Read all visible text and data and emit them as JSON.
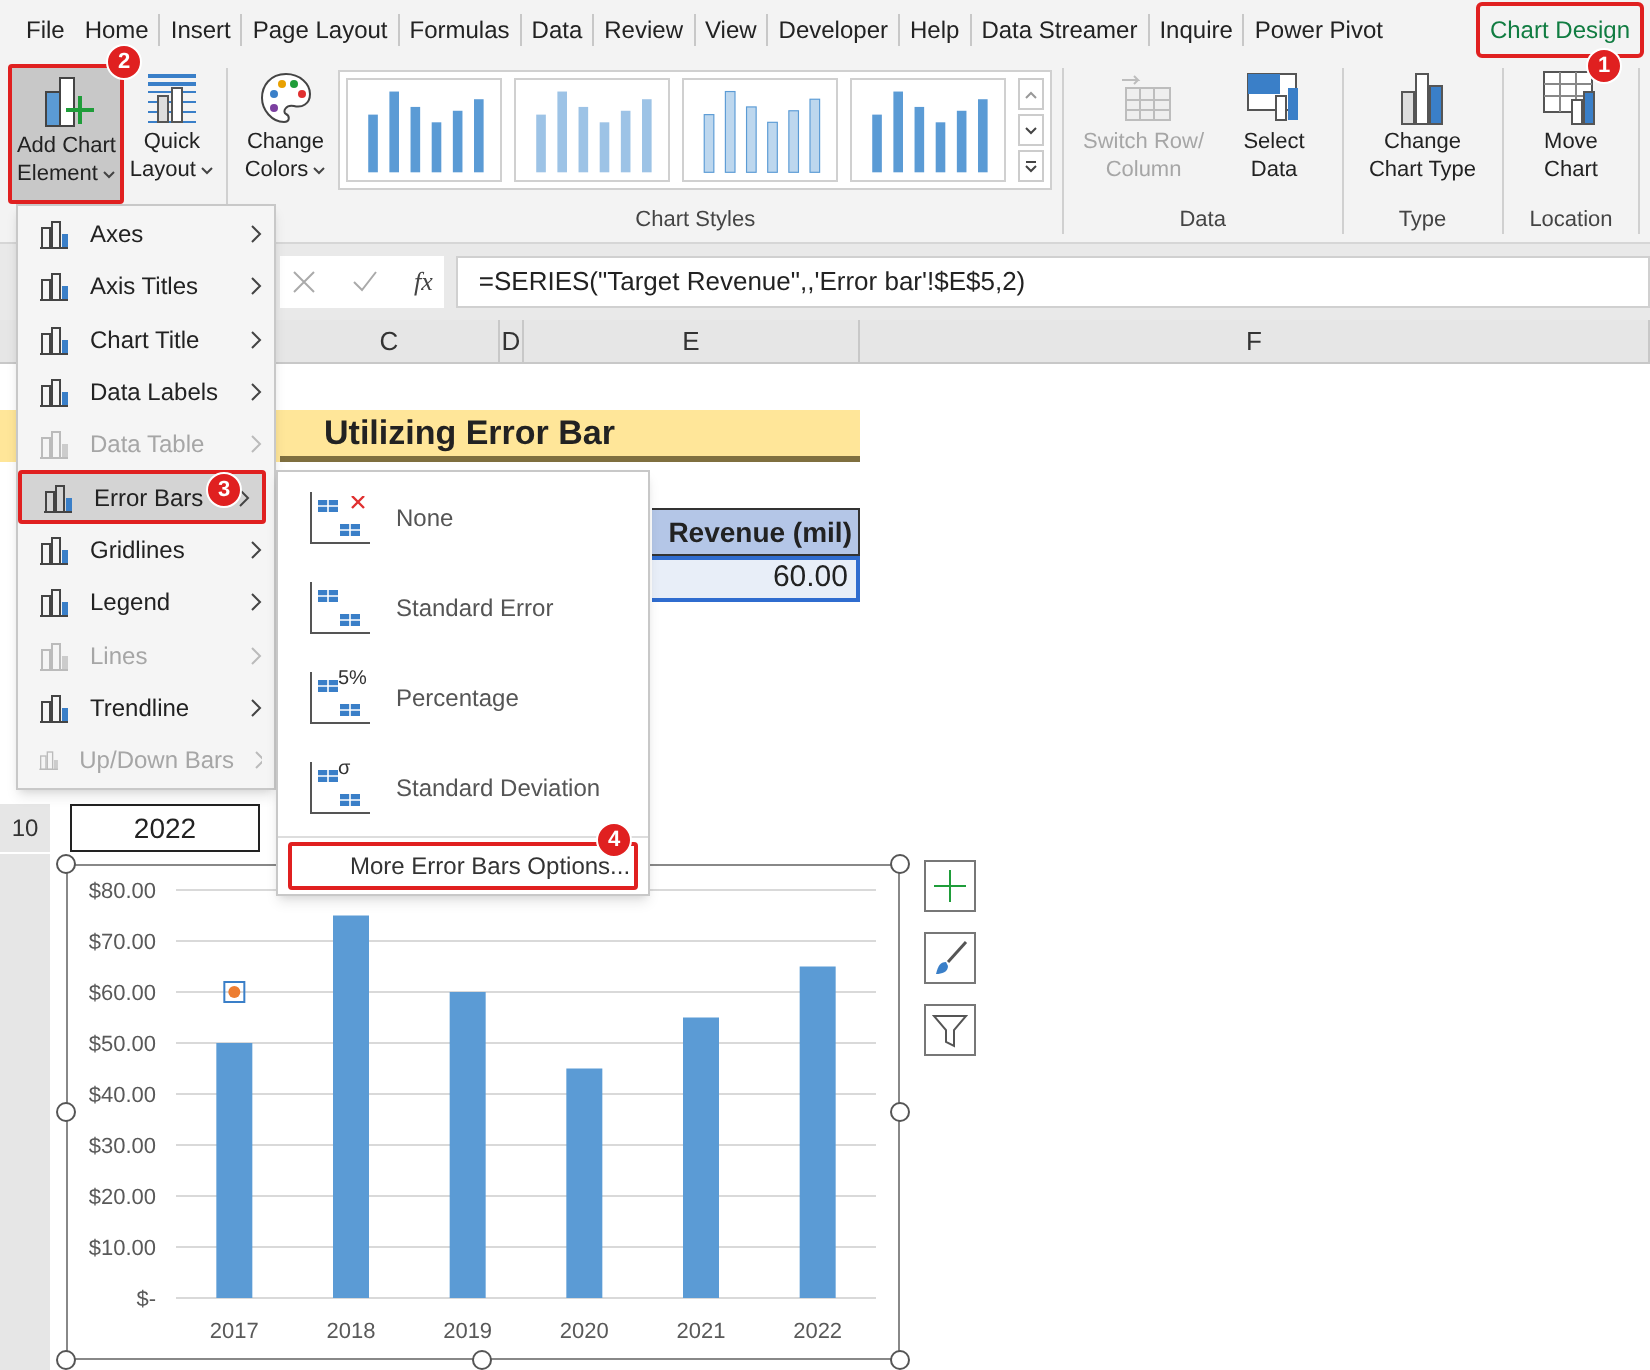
{
  "tabs": [
    {
      "label": "File",
      "selected": false
    },
    {
      "label": "Home",
      "selected": false
    },
    {
      "label": "Insert",
      "selected": false
    },
    {
      "label": "Page Layout",
      "selected": false
    },
    {
      "label": "Formulas",
      "selected": false
    },
    {
      "label": "Data",
      "selected": false
    },
    {
      "label": "Review",
      "selected": false
    },
    {
      "label": "View",
      "selected": false
    },
    {
      "label": "Developer",
      "selected": false
    },
    {
      "label": "Help",
      "selected": false
    },
    {
      "label": "Data Streamer",
      "selected": false
    },
    {
      "label": "Inquire",
      "selected": false
    },
    {
      "label": "Power Pivot",
      "selected": false
    },
    {
      "label": "Chart Design",
      "selected": true,
      "step": "1"
    }
  ],
  "ribbon": {
    "add_chart_element": {
      "label": "Add Chart Element",
      "pressed": true,
      "step": "2"
    },
    "quick_layout": {
      "label": "Quick Layout"
    },
    "change_colors": {
      "label": "Change Colors"
    },
    "chart_styles": {
      "label": "Chart Styles",
      "thumbnails": [
        {
          "kind": "solid"
        },
        {
          "kind": "striped"
        },
        {
          "kind": "outlined"
        },
        {
          "kind": "solid"
        }
      ]
    },
    "groups": [
      {
        "label": "Data",
        "buttons": [
          {
            "kind": "switch",
            "label": "Switch Row/ Column",
            "disabled": true
          },
          {
            "kind": "select",
            "label": "Select Data",
            "disabled": false
          }
        ]
      },
      {
        "label": "Type",
        "buttons": [
          {
            "kind": "type",
            "label": "Change Chart Type",
            "disabled": false
          }
        ]
      },
      {
        "label": "Location",
        "buttons": [
          {
            "kind": "move",
            "label": "Move Chart",
            "disabled": false
          }
        ]
      }
    ]
  },
  "formula_bar": {
    "fx": "fx",
    "formula": "=SERIES(\"Target Revenue\",,'Error bar'!$E$5,2)"
  },
  "columns": [
    "C",
    "D",
    "E",
    "F"
  ],
  "sheet": {
    "title": "Utilizing Error Bar",
    "header": "Revenue (mil)",
    "value": "60.00",
    "rows": [
      {
        "number": "10",
        "year": "2022"
      }
    ]
  },
  "chart": {
    "chart_data": {
      "type": "bar",
      "grid": true,
      "categories": [
        "2017",
        "2018",
        "2019",
        "2020",
        "2021",
        "2022"
      ],
      "series": [
        {
          "color": "#5b9bd5",
          "values": [
            50,
            75,
            60,
            45,
            55,
            65
          ]
        }
      ],
      "ylim": [
        0,
        80
      ],
      "yticks": [
        {
          "value": 0,
          "label": "$-"
        },
        {
          "value": 10,
          "label": "$10.00"
        },
        {
          "value": 20,
          "label": "$20.00"
        },
        {
          "value": 30,
          "label": "$30.00"
        },
        {
          "value": 40,
          "label": "$40.00"
        },
        {
          "value": 50,
          "label": "$50.00"
        },
        {
          "value": 60,
          "label": "$60.00"
        },
        {
          "value": 70,
          "label": "$70.00"
        },
        {
          "value": 80,
          "label": "$80.00"
        }
      ]
    }
  },
  "menu": {
    "items": [
      {
        "label": "Axes",
        "disabled": false,
        "selected": false
      },
      {
        "label": "Axis Titles",
        "disabled": false,
        "selected": false
      },
      {
        "label": "Chart Title",
        "disabled": false,
        "selected": false
      },
      {
        "label": "Data Labels",
        "disabled": false,
        "selected": false
      },
      {
        "label": "Data Table",
        "disabled": true,
        "selected": false
      },
      {
        "label": "Error Bars",
        "disabled": false,
        "selected": true,
        "step": "3"
      },
      {
        "label": "Gridlines",
        "disabled": false,
        "selected": false
      },
      {
        "label": "Legend",
        "disabled": false,
        "selected": false
      },
      {
        "label": "Lines",
        "disabled": true,
        "selected": false
      },
      {
        "label": "Trendline",
        "disabled": false,
        "selected": false
      },
      {
        "label": "Up/Down Bars",
        "disabled": true,
        "selected": false
      }
    ]
  },
  "submenu": {
    "items": [
      {
        "kind": "none",
        "label": "None",
        "selected": false
      },
      {
        "kind": "standard_error",
        "label": "Standard Error",
        "selected": false
      },
      {
        "kind": "percentage",
        "label": "Percentage",
        "icon_text": "5%",
        "selected": false
      },
      {
        "kind": "standard_deviation",
        "label": "Standard Deviation",
        "icon_text": "σ",
        "selected": false
      }
    ],
    "more": {
      "label": "More Error Bars Options...",
      "step": "4",
      "selected": true
    }
  }
}
